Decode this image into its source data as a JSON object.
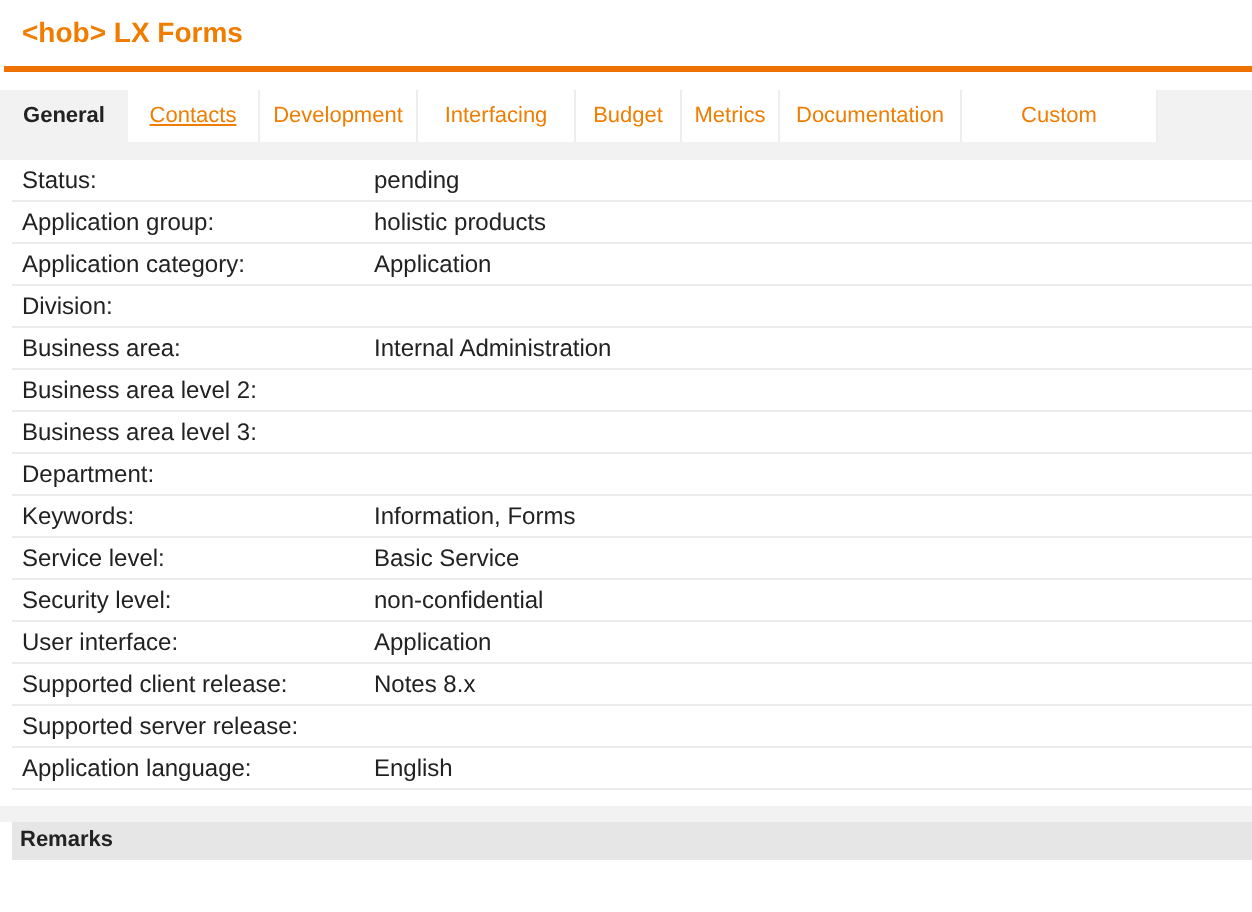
{
  "header": {
    "title": "<hob> LX Forms"
  },
  "tabs": [
    {
      "label": "General",
      "selected": true,
      "hovered": false
    },
    {
      "label": "Contacts",
      "selected": false,
      "hovered": true
    },
    {
      "label": "Development",
      "selected": false,
      "hovered": false
    },
    {
      "label": "Interfacing",
      "selected": false,
      "hovered": false
    },
    {
      "label": "Budget",
      "selected": false,
      "hovered": false
    },
    {
      "label": "Metrics",
      "selected": false,
      "hovered": false
    },
    {
      "label": "Documentation",
      "selected": false,
      "hovered": false
    },
    {
      "label": "Custom",
      "selected": false,
      "hovered": false
    }
  ],
  "fields": [
    {
      "label": "Status:",
      "value": "pending"
    },
    {
      "label": "Application group:",
      "value": "holistic products"
    },
    {
      "label": "Application category:",
      "value": "Application"
    },
    {
      "label": "Division:"
    },
    {
      "label": "Business area:",
      "value": "Internal Administration"
    },
    {
      "label": "Business area level 2:"
    },
    {
      "label": "Business area level 3:"
    },
    {
      "label": "Department:"
    },
    {
      "label": "Keywords:",
      "value": "Information, Forms"
    },
    {
      "label": "Service level:",
      "value": "Basic Service"
    },
    {
      "label": "Security level:",
      "value": "non-confidential"
    },
    {
      "label": "User interface:",
      "value": "Application"
    },
    {
      "label": "Supported client release:",
      "value": "Notes 8.x"
    },
    {
      "label": "Supported server release:"
    },
    {
      "label": "Application language:",
      "value": "English"
    }
  ],
  "remarks": {
    "title": "Remarks"
  }
}
